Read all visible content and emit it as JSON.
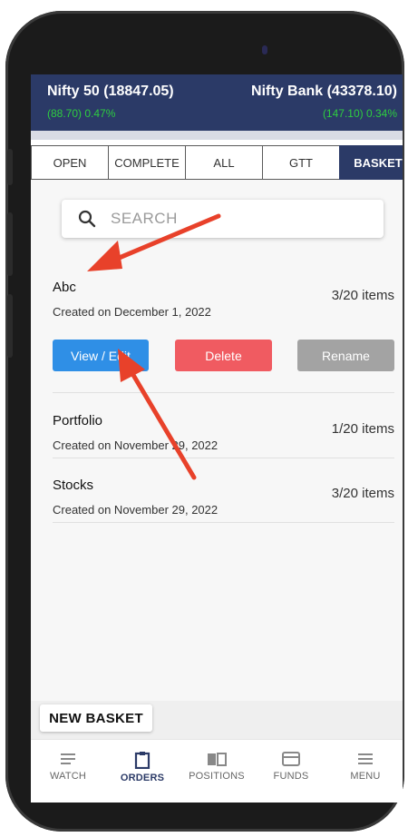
{
  "header": {
    "left_index": {
      "name": "Nifty 50 (18847.05)",
      "change": "(88.70) 0.47%"
    },
    "right_index": {
      "name": "Nifty Bank (43378.10)",
      "change": "(147.10) 0.34%"
    },
    "change_color": "#2ecc40"
  },
  "tabs": [
    {
      "label": "OPEN"
    },
    {
      "label": "COMPLETE"
    },
    {
      "label": "ALL"
    },
    {
      "label": "GTT"
    },
    {
      "label": "BASKET",
      "active": true
    }
  ],
  "search": {
    "placeholder": "SEARCH",
    "icon": "search-icon"
  },
  "baskets": [
    {
      "name": "Abc",
      "created": "Created on December 1, 2022",
      "items": "3/20 items"
    },
    {
      "name": "Portfolio",
      "created": "Created on November 29, 2022",
      "items": "1/20 items"
    },
    {
      "name": "Stocks",
      "created": "Created on November 29, 2022",
      "items": "3/20 items"
    }
  ],
  "actions": {
    "view_edit": "View / Edit",
    "delete": "Delete",
    "rename": "Rename"
  },
  "new_basket": "NEW BASKET",
  "nav": [
    {
      "label": "WATCH",
      "icon": "list-icon"
    },
    {
      "label": "ORDERS",
      "icon": "clipboard-icon",
      "active": true
    },
    {
      "label": "POSITIONS",
      "icon": "book-icon"
    },
    {
      "label": "FUNDS",
      "icon": "wallet-icon"
    },
    {
      "label": "MENU",
      "icon": "menu-icon"
    }
  ],
  "colors": {
    "brand": "#2b3a67",
    "view_edit": "#2f8fe6",
    "delete": "#f05b61",
    "rename": "#a3a3a3",
    "annotation_arrow": "#e8412a"
  }
}
